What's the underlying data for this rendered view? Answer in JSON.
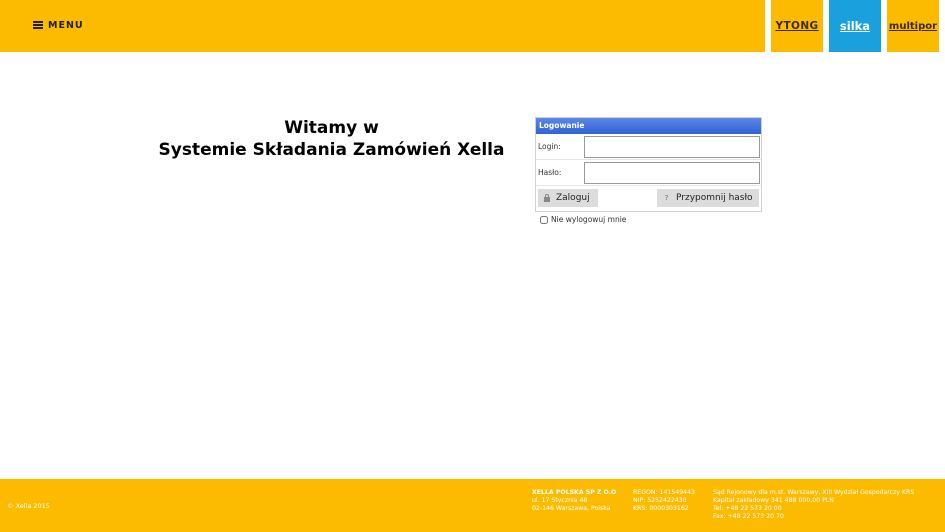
{
  "header": {
    "menu_label": "MENU",
    "brands": [
      {
        "label": "YTONG",
        "color": "#fdbb00",
        "text_color": "#3a2b13"
      },
      {
        "label": "silka",
        "color": "#1aa0dc",
        "text_color": "#ffffff"
      },
      {
        "label": "multipor",
        "color": "#fdbb00",
        "text_color": "#3a2b13"
      }
    ],
    "background": "#fdbb00"
  },
  "welcome": {
    "line1": "Witamy w",
    "line2": "Systemie Składania Zamówień Xella"
  },
  "login": {
    "title": "Logowanie",
    "login_label": "Login:",
    "login_value": "",
    "password_label": "Hasło:",
    "password_value": "",
    "login_button": "Zaloguj",
    "login_button_icon": "lock-icon",
    "remind_button": "Przypomnij hasło",
    "remind_button_icon": "question-icon",
    "remember_label": "Nie wylogowuj mnie",
    "remember_checked": false
  },
  "footer": {
    "copyright": "© Xella 2015",
    "company": {
      "name": "XELLA POLSKA SP Z O.O",
      "address1": "ul. 17 Stycznia 48",
      "address2": "02-146 Warszawa, Polska"
    },
    "registry": {
      "regon": "REGON: 141549443",
      "nip": "NIP: 5252422430",
      "krs": "KRS: 0000303162"
    },
    "court": {
      "line1": "Sąd Rejonowy dla m.st. Warszawy, XIII Wydział Gospodarczy KRS",
      "line2": "Kapitał zakładowy 341 488 000,00 PLN",
      "tel": "Tel: +48 22 573 20 00",
      "fax": "Fax: +48 22 573 20 70"
    }
  }
}
